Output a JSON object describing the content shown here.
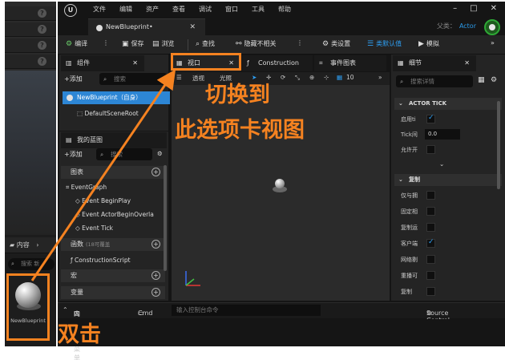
{
  "menu": [
    "文件",
    "编辑",
    "资产",
    "查看",
    "调试",
    "窗口",
    "工具",
    "帮助"
  ],
  "document_tab": "NewBlueprint•",
  "parent_class": {
    "label": "父类：",
    "value": "Actor"
  },
  "toolbar": {
    "compile": "编译",
    "save": "保存",
    "browse": "浏览",
    "find": "查找",
    "hide_unrelated": "隐藏不相关",
    "class_settings": "类设置",
    "class_defaults": "类默认值",
    "simulate": "模拟"
  },
  "components": {
    "tab": "组件",
    "add": "添加",
    "search_placeholder": "搜索",
    "root_item": "NewBlueprint（自身）",
    "child_item": "DefaultSceneRoot"
  },
  "my_blueprint": {
    "tab": "我的蓝图",
    "add": "添加",
    "search_placeholder": "搜索",
    "graphs": "图表",
    "event_graph": "EventGraph",
    "events": [
      "Event BeginPlay",
      "Event ActorBeginOverla",
      "Event Tick"
    ],
    "functions": "函数",
    "functions_note": "(18可覆盖",
    "construction_script": "ConstructionScript",
    "macros": "宏",
    "variables": "变量"
  },
  "center_tabs": {
    "viewport": "视口",
    "construction": "Construction",
    "event_graph": "事件图表"
  },
  "viewport_toolbar": {
    "perspective": "透视",
    "lit": "光照",
    "grid_value": "10"
  },
  "details": {
    "tab": "细节",
    "search_placeholder": "搜索详情",
    "section_actor_tick": "ACTOR TICK",
    "tick_rows": [
      {
        "label": "启用ti",
        "type": "check",
        "checked": true
      },
      {
        "label": "Tick间",
        "type": "number",
        "value": "0.0"
      },
      {
        "label": "允许开",
        "type": "check",
        "checked": false
      }
    ],
    "section_replication": "复制",
    "rep_rows": [
      {
        "label": "仅与拥",
        "checked": false
      },
      {
        "label": "固定相",
        "checked": false
      },
      {
        "label": "复制运",
        "checked": false
      },
      {
        "label": "客户端",
        "checked": true
      },
      {
        "label": "网络剔",
        "checked": false
      },
      {
        "label": "重播可",
        "checked": false
      },
      {
        "label": "复制",
        "checked": false
      }
    ]
  },
  "bottom_bar": {
    "drawer": "内容侧滑菜单",
    "cmd": "Cmd",
    "console_placeholder": "输入控制台命令",
    "source_control": "Source Control Off"
  },
  "content_browser": {
    "label": "内容",
    "search_placeholder": "搜索 新",
    "asset_name": "NewBlueprint"
  },
  "annotations": {
    "switch_line1": "切换到",
    "switch_line2": "此选项卡视图",
    "double_click": "双击"
  },
  "colors": {
    "accent_orange": "#f58220",
    "selection_blue": "#2d86d5",
    "link_blue": "#2b9ae8"
  }
}
